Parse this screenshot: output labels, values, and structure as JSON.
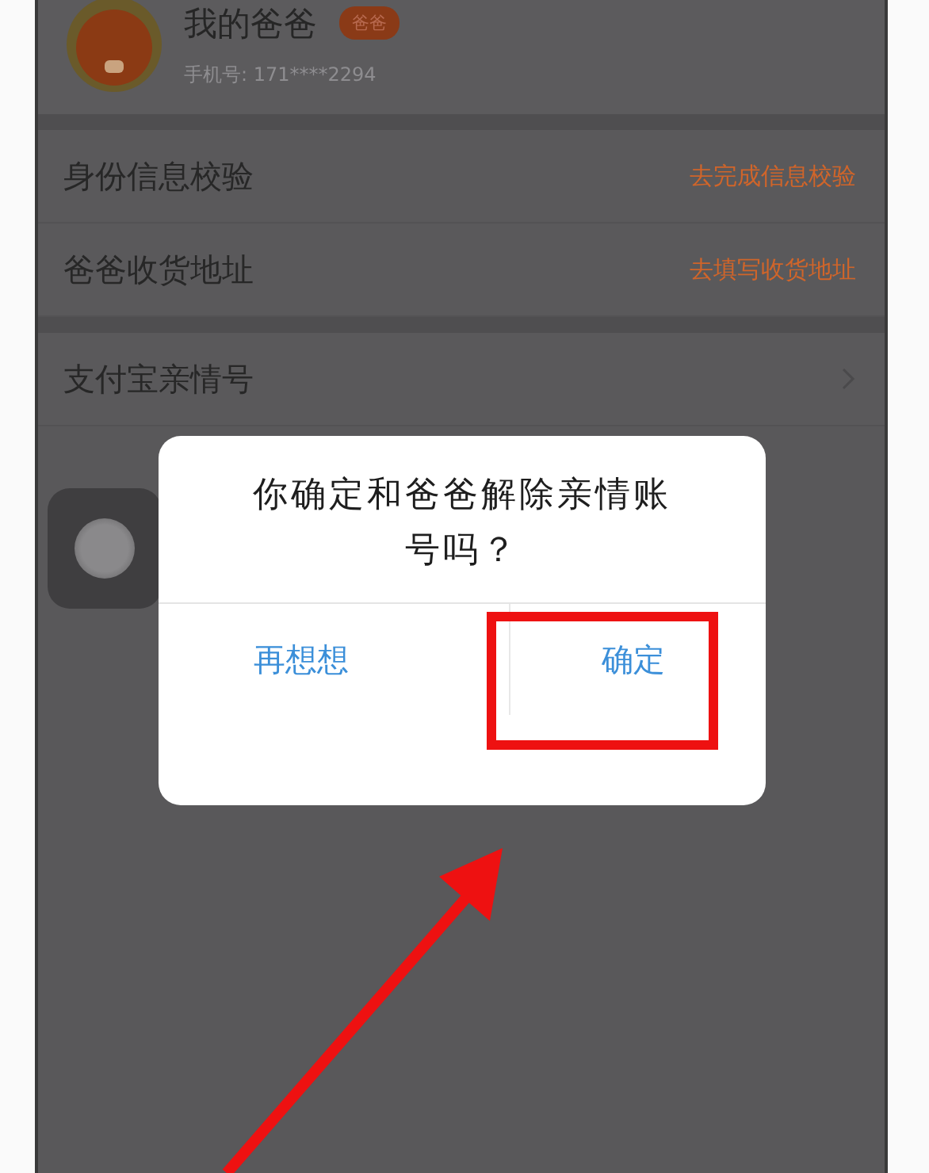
{
  "profile": {
    "name": "我的爸爸",
    "badge": "爸爸",
    "phone": "手机号: 171****2294"
  },
  "rows": [
    {
      "label": "身份信息校验",
      "action": "去完成信息校验",
      "kind": "action"
    },
    {
      "label": "爸爸收货地址",
      "action": "去填写收货地址",
      "kind": "action"
    },
    {
      "label": "支付宝亲情号",
      "kind": "link"
    }
  ],
  "dialog": {
    "message": "你确定和爸爸解除亲情账号吗？",
    "buttons": [
      {
        "label": "再想想",
        "highlighted": false
      },
      {
        "label": "确定",
        "highlighted": true
      }
    ]
  }
}
